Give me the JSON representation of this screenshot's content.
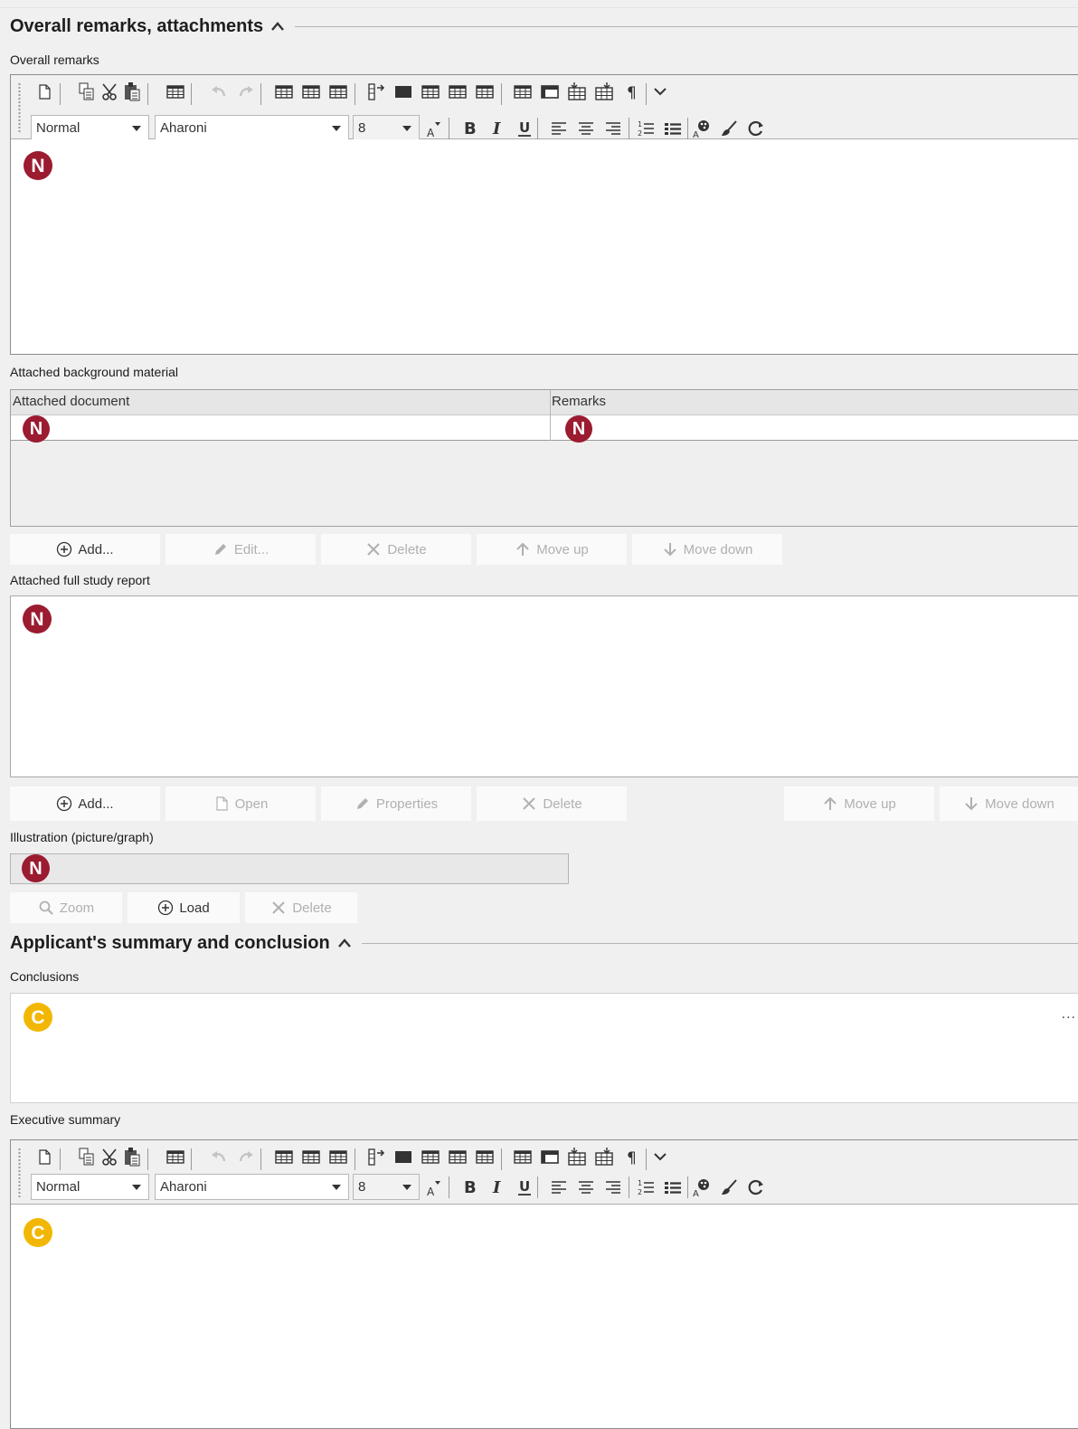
{
  "section_remarks": {
    "title": "Overall remarks, attachments",
    "overall_remarks_label": "Overall remarks",
    "attached_background_label": "Attached background material",
    "attached_full_study_label": "Attached full study report",
    "illustration_label": "Illustration (picture/graph)"
  },
  "editor_toolbar": {
    "style_value": "Normal",
    "font_value": "Aharoni",
    "size_value": "8"
  },
  "badges": {
    "n": "N",
    "c": "C"
  },
  "background_table": {
    "columns": [
      "Attached document",
      "Remarks"
    ]
  },
  "background_buttons": {
    "add": "Add...",
    "edit": "Edit...",
    "delete": "Delete",
    "move_up": "Move up",
    "move_down": "Move down"
  },
  "full_study_buttons": {
    "add": "Add...",
    "open": "Open",
    "properties": "Properties",
    "delete": "Delete",
    "move_up": "Move up",
    "move_down": "Move down"
  },
  "illustration_buttons": {
    "zoom": "Zoom",
    "load": "Load",
    "delete": "Delete"
  },
  "section_summary": {
    "title": "Applicant's summary and conclusion",
    "conclusions_label": "Conclusions",
    "conclusions_more": "...",
    "executive_summary_label": "Executive summary"
  },
  "colors": {
    "badge_n": "#9b1b31",
    "badge_c": "#f2b705"
  }
}
